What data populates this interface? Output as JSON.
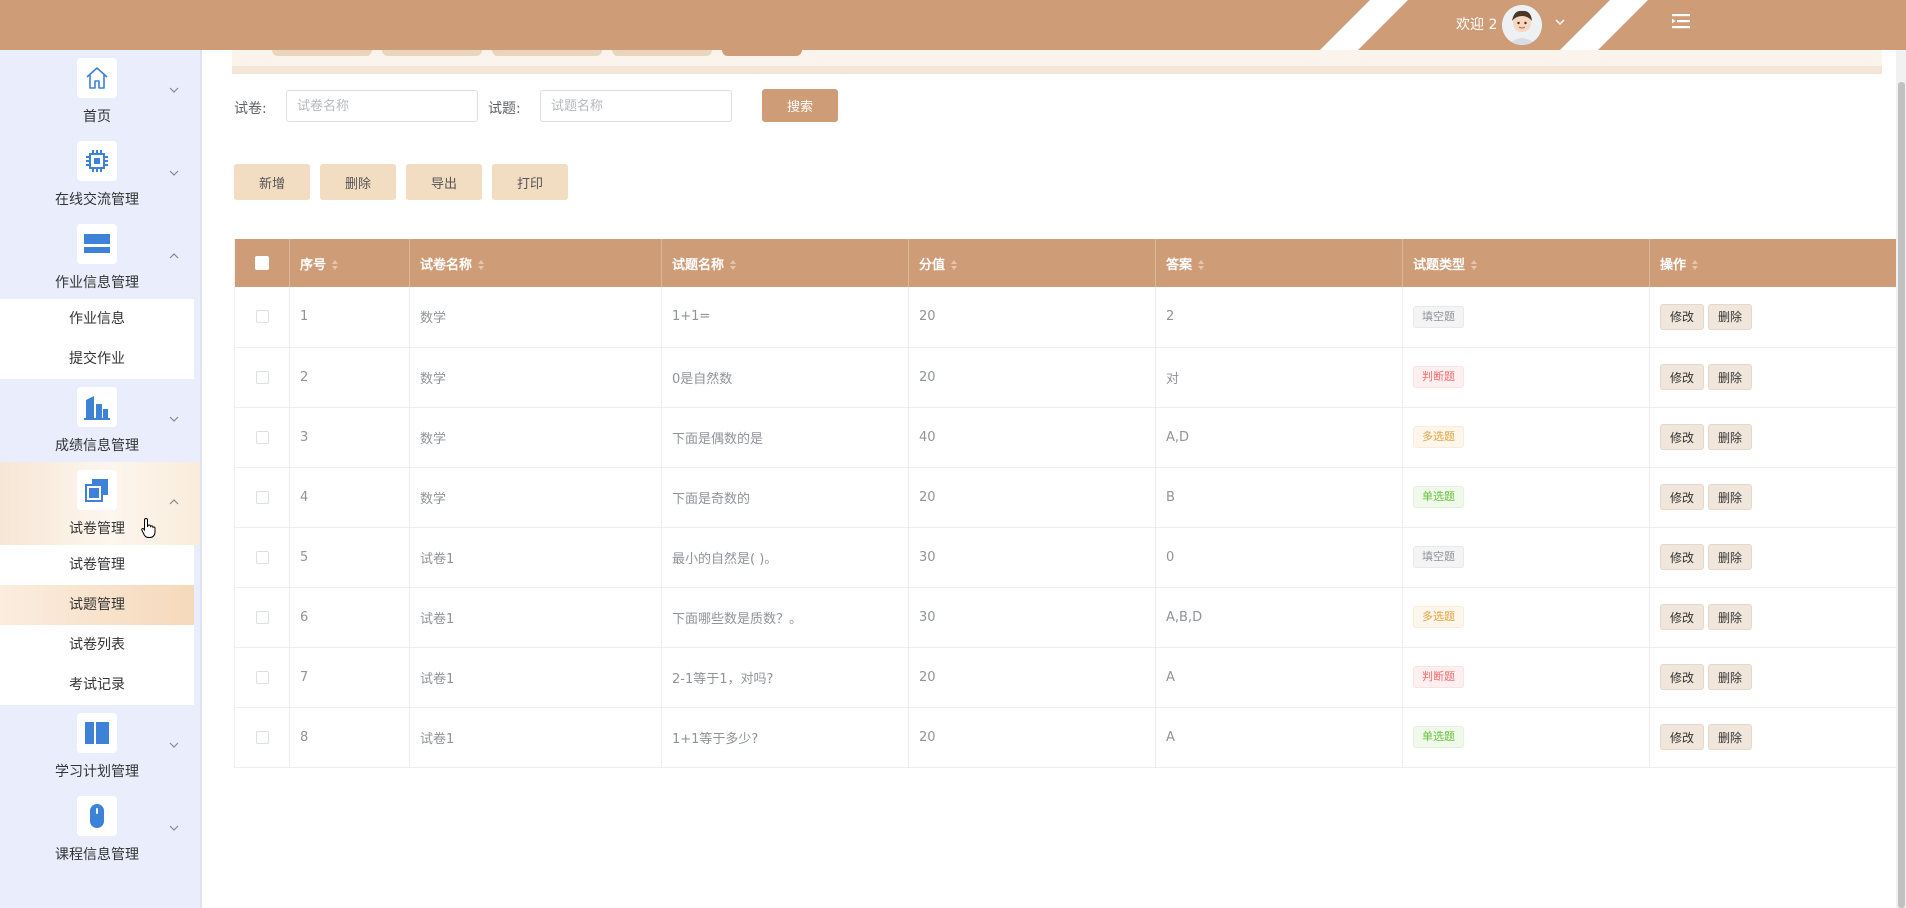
{
  "header": {
    "welcome": "欢迎 2"
  },
  "sidebar": {
    "groups": [
      {
        "label": "首页",
        "icon": "home-icon",
        "expanded": false
      },
      {
        "label": "在线交流管理",
        "icon": "chip-icon",
        "expanded": false
      },
      {
        "label": "作业信息管理",
        "icon": "window-icon",
        "expanded": true,
        "items": [
          "作业信息",
          "提交作业"
        ]
      },
      {
        "label": "成绩信息管理",
        "icon": "building-icon",
        "expanded": false
      },
      {
        "label": "试卷管理",
        "icon": "copy-icon",
        "expanded": true,
        "items": [
          "试卷管理",
          "试题管理",
          "试卷列表",
          "考试记录"
        ],
        "active_item": "试题管理"
      },
      {
        "label": "学习计划管理",
        "icon": "panel-icon",
        "expanded": false
      },
      {
        "label": "课程信息管理",
        "icon": "mouse-icon",
        "expanded": false
      }
    ]
  },
  "search": {
    "paper_label": "试卷:",
    "paper_placeholder": "试卷名称",
    "question_label": "试题:",
    "question_placeholder": "试题名称",
    "button": "搜索"
  },
  "toolbar": {
    "add": "新增",
    "delete": "删除",
    "export": "导出",
    "print": "打印"
  },
  "table": {
    "columns": [
      "序号",
      "试卷名称",
      "试题名称",
      "分值",
      "答案",
      "试题类型",
      "操作"
    ],
    "rows": [
      {
        "no": "1",
        "paper": "数学",
        "question": "1+1=",
        "score": "20",
        "answer": "2",
        "type": "填空题",
        "type_style": "fill"
      },
      {
        "no": "2",
        "paper": "数学",
        "question": "0是自然数",
        "score": "20",
        "answer": "对",
        "type": "判断题",
        "type_style": "judge"
      },
      {
        "no": "3",
        "paper": "数学",
        "question": "下面是偶数的是",
        "score": "40",
        "answer": "A,D",
        "type": "多选题",
        "type_style": "multi"
      },
      {
        "no": "4",
        "paper": "数学",
        "question": "下面是奇数的",
        "score": "20",
        "answer": "B",
        "type": "单选题",
        "type_style": "single"
      },
      {
        "no": "5",
        "paper": "试卷1",
        "question": "最小的自然是( )。",
        "score": "30",
        "answer": "0",
        "type": "填空题",
        "type_style": "fill"
      },
      {
        "no": "6",
        "paper": "试卷1",
        "question": "下面哪些数是质数？。",
        "score": "30",
        "answer": "A,B,D",
        "type": "多选题",
        "type_style": "multi"
      },
      {
        "no": "7",
        "paper": "试卷1",
        "question": "2-1等于1，对吗?",
        "score": "20",
        "answer": "A",
        "type": "判断题",
        "type_style": "judge"
      },
      {
        "no": "8",
        "paper": "试卷1",
        "question": "1+1等于多少?",
        "score": "20",
        "answer": "A",
        "type": "单选题",
        "type_style": "single"
      }
    ],
    "edit_label": "修改",
    "delete_label": "删除"
  },
  "colors": {
    "primary": "#cf9c78",
    "sidebar_bg": "#eaeefc",
    "icon_blue": "#3d82d6",
    "button_light": "#f2dcc2"
  }
}
